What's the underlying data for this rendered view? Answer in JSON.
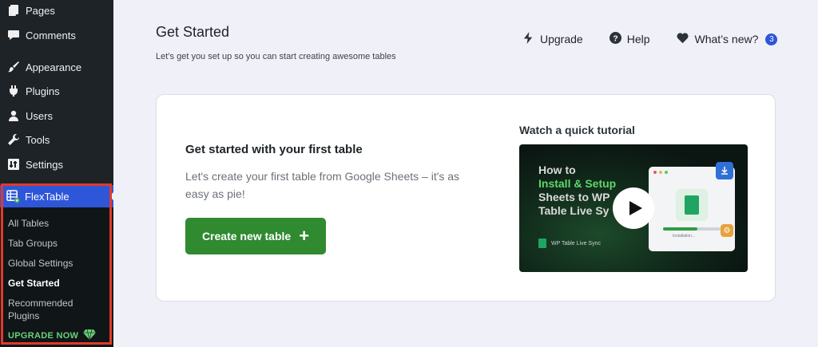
{
  "sidebar": {
    "items": [
      {
        "label": "Pages",
        "icon": "pages-icon"
      },
      {
        "label": "Comments",
        "icon": "comments-icon"
      },
      {
        "label": "Appearance",
        "icon": "appearance-icon"
      },
      {
        "label": "Plugins",
        "icon": "plugins-icon"
      },
      {
        "label": "Users",
        "icon": "users-icon"
      },
      {
        "label": "Tools",
        "icon": "tools-icon"
      },
      {
        "label": "Settings",
        "icon": "settings-icon"
      }
    ],
    "active_plugin": {
      "label": "FlexTable",
      "icon": "flextable-icon"
    },
    "submenu": [
      {
        "label": "All Tables"
      },
      {
        "label": "Tab Groups"
      },
      {
        "label": "Global Settings"
      },
      {
        "label": "Get Started",
        "active": true
      },
      {
        "label": "Recommended Plugins"
      }
    ],
    "upgrade_label": "UPGRADE NOW",
    "upgrade_icon": "diamond-icon"
  },
  "header": {
    "title": "Get Started",
    "subtitle": "Let’s get you set up so you can start creating awesome tables",
    "links": {
      "upgrade": "Upgrade",
      "help": "Help",
      "whats_new": "What’s new?",
      "whats_new_count": "3"
    }
  },
  "card": {
    "heading": "Get started with your first table",
    "description": "Let's create your first table from Google Sheets – it's as easy as pie!",
    "button_label": "Create new table",
    "button_icon": "plus-icon",
    "tutorial_title": "Watch a quick tutorial",
    "video": {
      "line1": "How to",
      "line2": "Install & Setup",
      "line3": "Sheets to WP",
      "line4": "Table Live Sy",
      "window_status": "Installation...",
      "brand": "WP Table Live Sync"
    }
  },
  "colors": {
    "sidebar_bg": "#1d2327",
    "active_blue": "#2e56d8",
    "highlight_red": "#e03a2a",
    "create_green": "#2f8a30",
    "upgrade_green": "#6ad17a"
  }
}
